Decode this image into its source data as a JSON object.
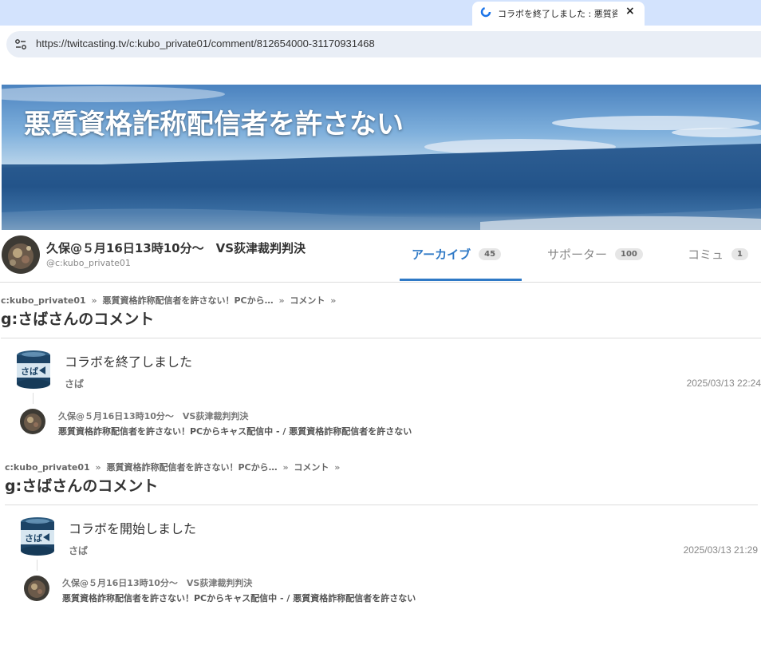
{
  "browser": {
    "tab_title": "コラボを終了しました : 悪質資格",
    "tab_close": "×",
    "url": "https://twitcasting.tv/c:kubo_private01/comment/812654000-31170931468"
  },
  "banner": {
    "title": "悪質資格詐称配信者を許さない"
  },
  "profile": {
    "name": "久保@５月16日13時10分〜　VS荻津裁判判決",
    "id": "@c:kubo_private01",
    "tabs": [
      {
        "label": "アーカイブ",
        "count": "45"
      },
      {
        "label": "サポーター",
        "count": "100"
      },
      {
        "label": "コミュ",
        "count": "1"
      }
    ]
  },
  "comments": [
    {
      "breadcrumb": [
        "c:kubo_private01",
        "悪質資格詐称配信者を許さない！PCから…",
        "コメント",
        ""
      ],
      "sep": "»",
      "title": "g:さばさんのコメント",
      "avatar_text": "さば",
      "text": "コラボを終了しました",
      "user": "さば",
      "time": "2025/03/13 22:24",
      "movie_title": "久保@５月16日13時10分〜　VS荻津裁判判決",
      "movie_subtitle": "悪質資格詐称配信者を許さない！PCからキャス配信中 - / 悪質資格詐称配信者を許さない"
    },
    {
      "breadcrumb": [
        "c:kubo_private01",
        "悪質資格詐称配信者を許さない！PCから…",
        "コメント",
        ""
      ],
      "sep": "»",
      "title": "g:さばさんのコメント",
      "avatar_text": "さば",
      "text": "コラボを開始しました",
      "user": "さば",
      "time": "2025/03/13 21:29",
      "movie_title": "久保@５月16日13時10分〜　VS荻津裁判判決",
      "movie_subtitle": "悪質資格詐称配信者を許さない！PCからキャス配信中 - / 悪質資格詐称配信者を許さない"
    }
  ],
  "colors": {
    "accent": "#2f79c6",
    "tabstrip": "#d3e3fd"
  }
}
